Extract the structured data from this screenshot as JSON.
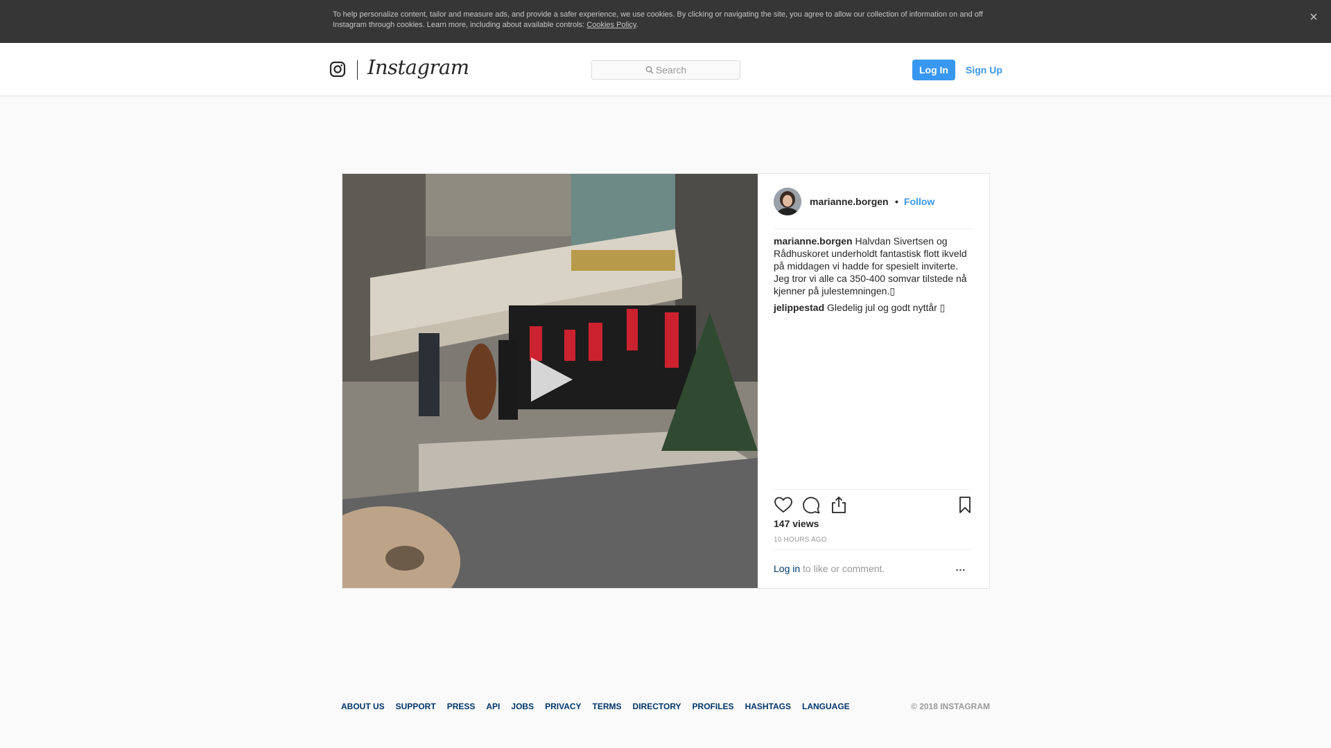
{
  "cookie_bar": {
    "text": "To help personalize content, tailor and measure ads, and provide a safer experience, we use cookies. By clicking or navigating the site, you agree to allow our collection of information on and off Instagram through cookies. Learn more, including about available controls: ",
    "link": "Cookies Policy",
    "suffix": ".",
    "close_icon": "close-icon"
  },
  "header": {
    "logo_text": "Instagram",
    "search_placeholder": "Search",
    "login_label": "Log In",
    "signup_label": "Sign Up"
  },
  "post": {
    "username": "marianne.borgen",
    "dot": "•",
    "follow_label": "Follow",
    "comments": [
      {
        "user": "marianne.borgen",
        "text": " Halvdan Sivertsen og Rådhuskoret underholdt fantastisk flott ikveld på middagen vi hadde for spesielt inviterte. Jeg tror vi alle ca 350-400 somvar tilstede nå kjenner på julestemningen.▯"
      },
      {
        "user": "jelippestad",
        "text": " Gledelig jul og godt nyttår ▯"
      }
    ],
    "views": "147 views",
    "time": "10 HOURS AGO",
    "login_link": "Log in",
    "login_suffix": " to like or comment.",
    "more_label": "..."
  },
  "footer": {
    "links": [
      "ABOUT US",
      "SUPPORT",
      "PRESS",
      "API",
      "JOBS",
      "PRIVACY",
      "TERMS",
      "DIRECTORY",
      "PROFILES",
      "HASHTAGS",
      "LANGUAGE"
    ],
    "copyright": "© 2018 INSTAGRAM"
  },
  "colors": {
    "accent": "#3897f0",
    "link": "#003569",
    "cookie_bg": "#363636"
  }
}
